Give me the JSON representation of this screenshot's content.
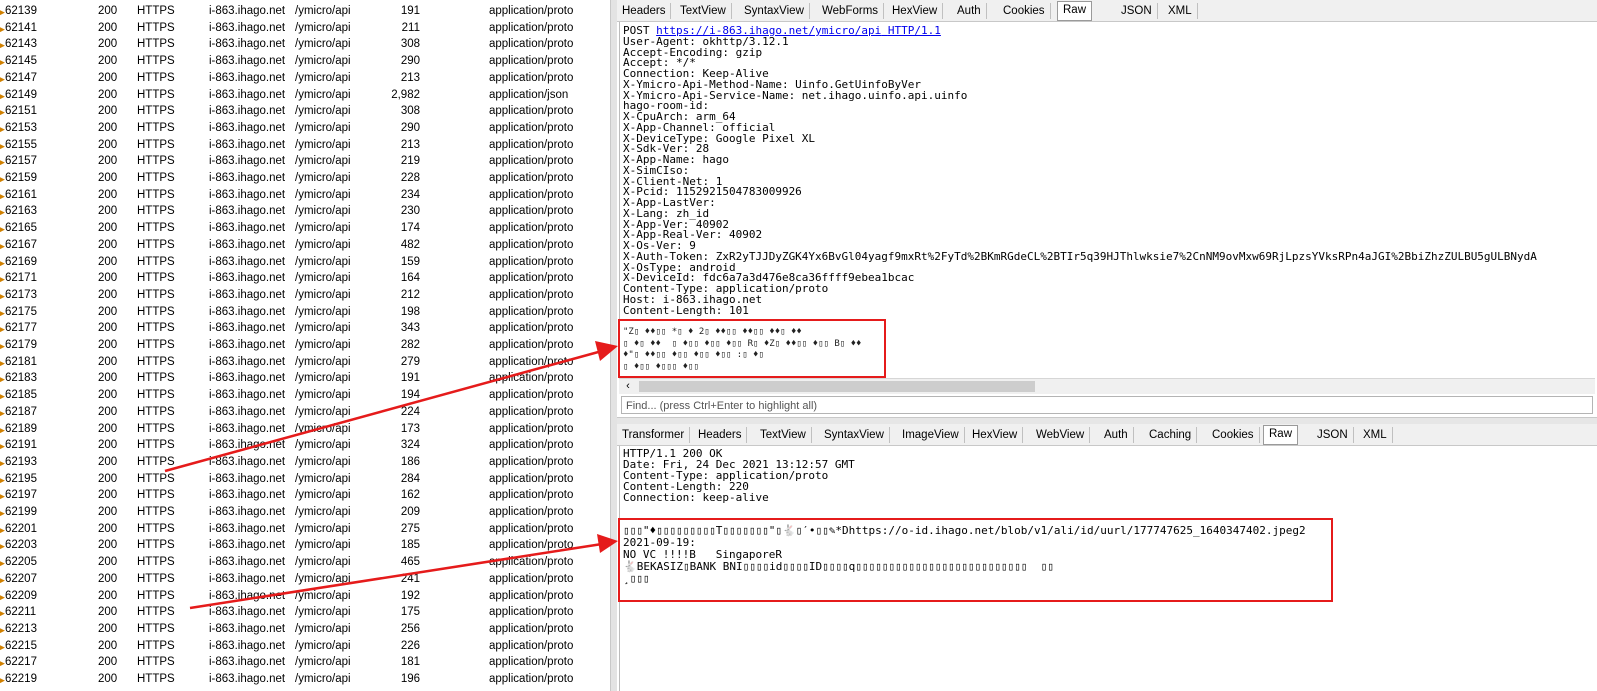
{
  "session_list": {
    "rows": [
      {
        "id": "62139",
        "result": "200",
        "protocol": "HTTPS",
        "host": "i-863.ihago.net",
        "url": "/ymicro/api",
        "body": "191",
        "content_type": "application/proto"
      },
      {
        "id": "62141",
        "result": "200",
        "protocol": "HTTPS",
        "host": "i-863.ihago.net",
        "url": "/ymicro/api",
        "body": "211",
        "content_type": "application/proto"
      },
      {
        "id": "62143",
        "result": "200",
        "protocol": "HTTPS",
        "host": "i-863.ihago.net",
        "url": "/ymicro/api",
        "body": "308",
        "content_type": "application/proto"
      },
      {
        "id": "62145",
        "result": "200",
        "protocol": "HTTPS",
        "host": "i-863.ihago.net",
        "url": "/ymicro/api",
        "body": "290",
        "content_type": "application/proto"
      },
      {
        "id": "62147",
        "result": "200",
        "protocol": "HTTPS",
        "host": "i-863.ihago.net",
        "url": "/ymicro/api",
        "body": "213",
        "content_type": "application/proto"
      },
      {
        "id": "62149",
        "result": "200",
        "protocol": "HTTPS",
        "host": "i-863.ihago.net",
        "url": "/ymicro/api",
        "body": "2,982",
        "content_type": "application/json"
      },
      {
        "id": "62151",
        "result": "200",
        "protocol": "HTTPS",
        "host": "i-863.ihago.net",
        "url": "/ymicro/api",
        "body": "308",
        "content_type": "application/proto"
      },
      {
        "id": "62153",
        "result": "200",
        "protocol": "HTTPS",
        "host": "i-863.ihago.net",
        "url": "/ymicro/api",
        "body": "290",
        "content_type": "application/proto"
      },
      {
        "id": "62155",
        "result": "200",
        "protocol": "HTTPS",
        "host": "i-863.ihago.net",
        "url": "/ymicro/api",
        "body": "213",
        "content_type": "application/proto"
      },
      {
        "id": "62157",
        "result": "200",
        "protocol": "HTTPS",
        "host": "i-863.ihago.net",
        "url": "/ymicro/api",
        "body": "219",
        "content_type": "application/proto"
      },
      {
        "id": "62159",
        "result": "200",
        "protocol": "HTTPS",
        "host": "i-863.ihago.net",
        "url": "/ymicro/api",
        "body": "228",
        "content_type": "application/proto"
      },
      {
        "id": "62161",
        "result": "200",
        "protocol": "HTTPS",
        "host": "i-863.ihago.net",
        "url": "/ymicro/api",
        "body": "234",
        "content_type": "application/proto"
      },
      {
        "id": "62163",
        "result": "200",
        "protocol": "HTTPS",
        "host": "i-863.ihago.net",
        "url": "/ymicro/api",
        "body": "230",
        "content_type": "application/proto"
      },
      {
        "id": "62165",
        "result": "200",
        "protocol": "HTTPS",
        "host": "i-863.ihago.net",
        "url": "/ymicro/api",
        "body": "174",
        "content_type": "application/proto"
      },
      {
        "id": "62167",
        "result": "200",
        "protocol": "HTTPS",
        "host": "i-863.ihago.net",
        "url": "/ymicro/api",
        "body": "482",
        "content_type": "application/proto"
      },
      {
        "id": "62169",
        "result": "200",
        "protocol": "HTTPS",
        "host": "i-863.ihago.net",
        "url": "/ymicro/api",
        "body": "159",
        "content_type": "application/proto"
      },
      {
        "id": "62171",
        "result": "200",
        "protocol": "HTTPS",
        "host": "i-863.ihago.net",
        "url": "/ymicro/api",
        "body": "164",
        "content_type": "application/proto"
      },
      {
        "id": "62173",
        "result": "200",
        "protocol": "HTTPS",
        "host": "i-863.ihago.net",
        "url": "/ymicro/api",
        "body": "212",
        "content_type": "application/proto"
      },
      {
        "id": "62175",
        "result": "200",
        "protocol": "HTTPS",
        "host": "i-863.ihago.net",
        "url": "/ymicro/api",
        "body": "198",
        "content_type": "application/proto"
      },
      {
        "id": "62177",
        "result": "200",
        "protocol": "HTTPS",
        "host": "i-863.ihago.net",
        "url": "/ymicro/api",
        "body": "343",
        "content_type": "application/proto"
      },
      {
        "id": "62179",
        "result": "200",
        "protocol": "HTTPS",
        "host": "i-863.ihago.net",
        "url": "/ymicro/api",
        "body": "282",
        "content_type": "application/proto"
      },
      {
        "id": "62181",
        "result": "200",
        "protocol": "HTTPS",
        "host": "i-863.ihago.net",
        "url": "/ymicro/api",
        "body": "279",
        "content_type": "application/proto"
      },
      {
        "id": "62183",
        "result": "200",
        "protocol": "HTTPS",
        "host": "i-863.ihago.net",
        "url": "/ymicro/api",
        "body": "191",
        "content_type": "application/proto"
      },
      {
        "id": "62185",
        "result": "200",
        "protocol": "HTTPS",
        "host": "i-863.ihago.net",
        "url": "/ymicro/api",
        "body": "194",
        "content_type": "application/proto"
      },
      {
        "id": "62187",
        "result": "200",
        "protocol": "HTTPS",
        "host": "i-863.ihago.net",
        "url": "/ymicro/api",
        "body": "224",
        "content_type": "application/proto"
      },
      {
        "id": "62189",
        "result": "200",
        "protocol": "HTTPS",
        "host": "i-863.ihago.net",
        "url": "/ymicro/api",
        "body": "173",
        "content_type": "application/proto"
      },
      {
        "id": "62191",
        "result": "200",
        "protocol": "HTTPS",
        "host": "i-863.ihago.net",
        "url": "/ymicro/api",
        "body": "324",
        "content_type": "application/proto"
      },
      {
        "id": "62193",
        "result": "200",
        "protocol": "HTTPS",
        "host": "i-863.ihago.net",
        "url": "/ymicro/api",
        "body": "186",
        "content_type": "application/proto"
      },
      {
        "id": "62195",
        "result": "200",
        "protocol": "HTTPS",
        "host": "i-863.ihago.net",
        "url": "/ymicro/api",
        "body": "284",
        "content_type": "application/proto"
      },
      {
        "id": "62197",
        "result": "200",
        "protocol": "HTTPS",
        "host": "i-863.ihago.net",
        "url": "/ymicro/api",
        "body": "162",
        "content_type": "application/proto"
      },
      {
        "id": "62199",
        "result": "200",
        "protocol": "HTTPS",
        "host": "i-863.ihago.net",
        "url": "/ymicro/api",
        "body": "209",
        "content_type": "application/proto"
      },
      {
        "id": "62201",
        "result": "200",
        "protocol": "HTTPS",
        "host": "i-863.ihago.net",
        "url": "/ymicro/api",
        "body": "275",
        "content_type": "application/proto"
      },
      {
        "id": "62203",
        "result": "200",
        "protocol": "HTTPS",
        "host": "i-863.ihago.net",
        "url": "/ymicro/api",
        "body": "185",
        "content_type": "application/proto"
      },
      {
        "id": "62205",
        "result": "200",
        "protocol": "HTTPS",
        "host": "i-863.ihago.net",
        "url": "/ymicro/api",
        "body": "465",
        "content_type": "application/proto"
      },
      {
        "id": "62207",
        "result": "200",
        "protocol": "HTTPS",
        "host": "i-863.ihago.net",
        "url": "/ymicro/api",
        "body": "241",
        "content_type": "application/proto"
      },
      {
        "id": "62209",
        "result": "200",
        "protocol": "HTTPS",
        "host": "i-863.ihago.net",
        "url": "/ymicro/api",
        "body": "192",
        "content_type": "application/proto"
      },
      {
        "id": "62211",
        "result": "200",
        "protocol": "HTTPS",
        "host": "i-863.ihago.net",
        "url": "/ymicro/api",
        "body": "175",
        "content_type": "application/proto"
      },
      {
        "id": "62213",
        "result": "200",
        "protocol": "HTTPS",
        "host": "i-863.ihago.net",
        "url": "/ymicro/api",
        "body": "256",
        "content_type": "application/proto"
      },
      {
        "id": "62215",
        "result": "200",
        "protocol": "HTTPS",
        "host": "i-863.ihago.net",
        "url": "/ymicro/api",
        "body": "226",
        "content_type": "application/proto"
      },
      {
        "id": "62217",
        "result": "200",
        "protocol": "HTTPS",
        "host": "i-863.ihago.net",
        "url": "/ymicro/api",
        "body": "181",
        "content_type": "application/proto"
      },
      {
        "id": "62219",
        "result": "200",
        "protocol": "HTTPS",
        "host": "i-863.ihago.net",
        "url": "/ymicro/api",
        "body": "196",
        "content_type": "application/proto"
      }
    ]
  },
  "request_tabs": [
    {
      "label": "Headers",
      "active": false
    },
    {
      "label": "TextView",
      "active": false
    },
    {
      "label": "SyntaxView",
      "active": false
    },
    {
      "label": "WebForms",
      "active": false
    },
    {
      "label": "HexView",
      "active": false
    },
    {
      "label": "Auth",
      "active": false
    },
    {
      "label": "Cookies",
      "active": false
    },
    {
      "label": "Raw",
      "active": true
    },
    {
      "label": "JSON",
      "active": false
    },
    {
      "label": "XML",
      "active": false
    }
  ],
  "request": {
    "method": "POST",
    "url": "https://i-863.ihago.net/ymicro/api",
    "version": "HTTP/1.1",
    "headers": [
      "User-Agent: okhttp/3.12.1",
      "Accept-Encoding: gzip",
      "Accept: */*",
      "Connection: Keep-Alive",
      "X-Ymicro-Api-Method-Name: Uinfo.GetUinfoByVer",
      "X-Ymicro-Api-Service-Name: net.ihago.uinfo.api.uinfo",
      "hago-room-id:",
      "X-CpuArch: arm_64",
      "X-App-Channel: official",
      "X-DeviceType: Google Pixel XL",
      "X-Sdk-Ver: 28",
      "X-App-Name: hago",
      "X-SimCIso:",
      "X-Client-Net: 1",
      "X-Pcid: 1152921504783009926",
      "X-App-LastVer:",
      "X-Lang: zh_id",
      "X-App-Ver: 40902",
      "X-App-Real-Ver: 40902",
      "X-Os-Ver: 9",
      "X-Auth-Token: ZxR2yTJJDyZGK4Yx6BvGl04yagf9mxRt%2FyTd%2BKmRGdeCL%2BTIr5q39HJThlwksie7%2CnNM9ovMxw69RjLpzsYVksRPn4aJGI%2BbiZhzZULBU5gULBNydA",
      "X-OsType: android",
      "X-DeviceId: fdc6a7a3d476e8ca36ffff9ebea1bcac",
      "Content-Type: application/proto",
      "Host: i-863.ihago.net",
      "Content-Length: 101"
    ],
    "body_lines": [
      "\"Z▯ ♦♦▯▯ *▯ ♦ 2▯ ♦♦▯▯ ♦♦▯▯ ♦♦▯ ♦♦",
      "▯ ♦▯ ♦♦  ▯ ♦▯▯ ♦▯▯ ♦▯▯ R▯ ♦Z▯ ♦♦▯▯ ♦▯▯ B▯ ♦♦",
      "♦\"▯ ♦♦▯▯ ♦▯▯ ♦▯▯ ♦▯▯ :▯ ♦▯",
      "▯ ♦▯▯ ♦▯▯▯ ♦▯▯"
    ]
  },
  "find_bar": {
    "placeholder": "Find... (press Ctrl+Enter to highlight all)"
  },
  "response_tabs": [
    {
      "label": "Transformer",
      "active": false
    },
    {
      "label": "Headers",
      "active": false
    },
    {
      "label": "TextView",
      "active": false
    },
    {
      "label": "SyntaxView",
      "active": false
    },
    {
      "label": "ImageView",
      "active": false
    },
    {
      "label": "HexView",
      "active": false
    },
    {
      "label": "WebView",
      "active": false
    },
    {
      "label": "Auth",
      "active": false
    },
    {
      "label": "Caching",
      "active": false
    },
    {
      "label": "Cookies",
      "active": false
    },
    {
      "label": "Raw",
      "active": true
    },
    {
      "label": "JSON",
      "active": false
    },
    {
      "label": "XML",
      "active": false
    }
  ],
  "response": {
    "lines": [
      "HTTP/1.1 200 OK",
      "Date: Fri, 24 Dec 2021 13:12:57 GMT",
      "Content-Type: application/proto",
      "Content-Length: 220",
      "Connection: keep-alive"
    ],
    "body_lines": [
      "▯▯▯\"♦▯▯▯▯▯▯▯▯▯T▯▯▯▯▯▯▯\"▯🐇▯′•▯▯✎*Dhttps://o-id.ihago.net/blob/v1/ali/id/uurl/177747625_1640347402.jpeg2",
      "2021-09-19:",
      "NO VC !!!!B   SingaporeR",
      "🐇BEKASIZ▯BANK BNI▯▯▯▯id▯▯▯▯ID▯▯▯▯q▯▯▯▯▯▯▯▯▯▯▯▯▯▯▯▯▯▯▯▯▯▯▯▯▯▯  ▯▯",
      "¸▯▯▯"
    ]
  },
  "colors": {
    "annotation": "#e51b1b",
    "link": "#0000ee"
  }
}
